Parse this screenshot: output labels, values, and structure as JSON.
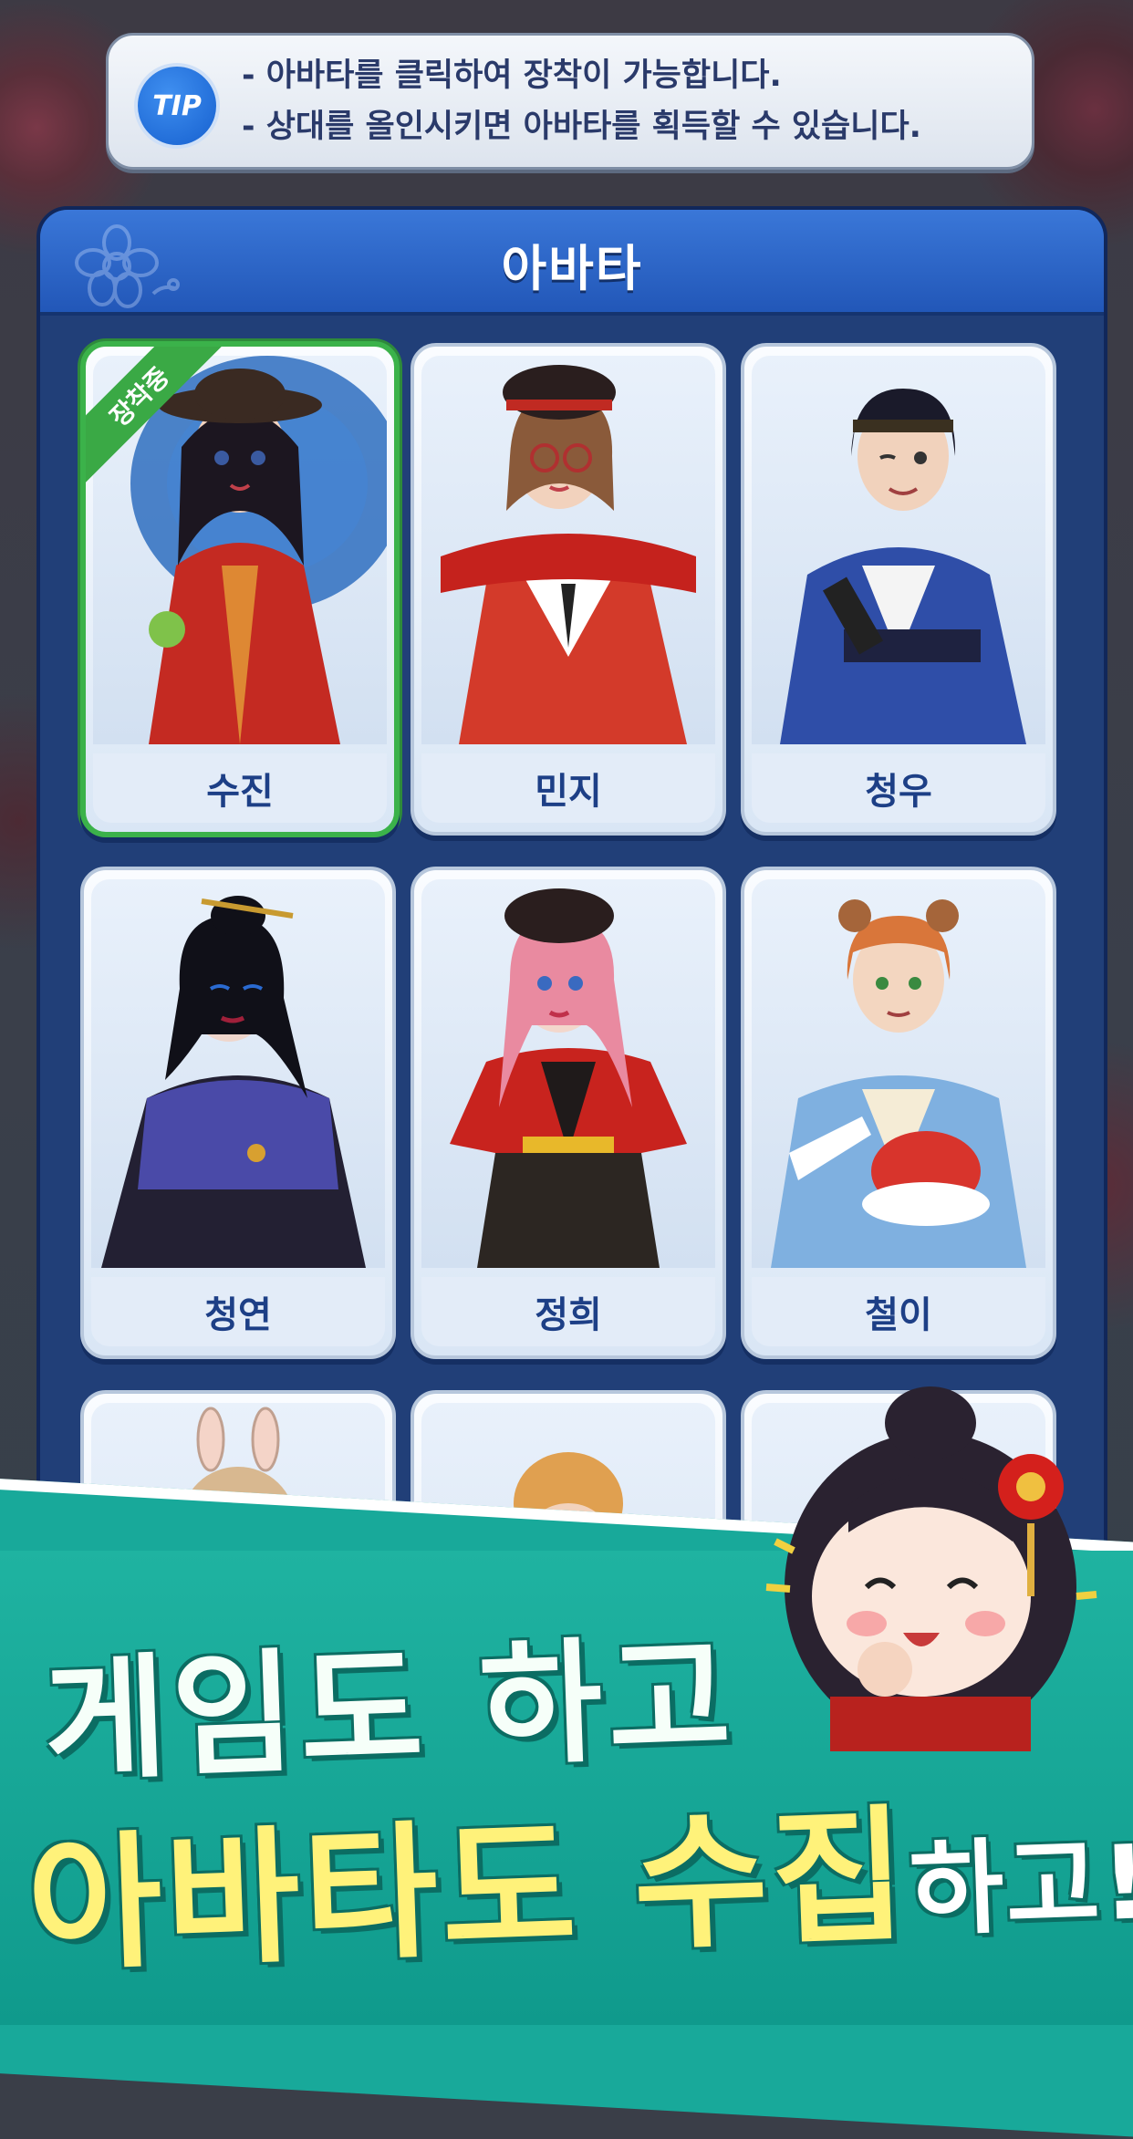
{
  "tip": {
    "badge": "TIP",
    "lines": [
      "- 아바타를 클릭하여 장착이 가능합니다.",
      "- 상대를 올인시키면 아바타를 획득할 수 있습니다."
    ]
  },
  "panel": {
    "title": "아바타",
    "equipped_label": "장착중",
    "avatars": [
      {
        "name": "수진",
        "equipped": true
      },
      {
        "name": "민지",
        "equipped": false
      },
      {
        "name": "청우",
        "equipped": false
      },
      {
        "name": "청연",
        "equipped": false
      },
      {
        "name": "정희",
        "equipped": false
      },
      {
        "name": "철이",
        "equipped": false
      },
      {
        "name": "",
        "equipped": false
      },
      {
        "name": "",
        "equipped": false
      },
      {
        "name": "",
        "equipped": false
      }
    ]
  },
  "promo": {
    "line1": "게임도 하고",
    "line2_highlight": "아바타도 수집",
    "line2_rest": "하고!"
  },
  "colors": {
    "panel_blue": "#1f3e78",
    "header_blue": "#2f6ad0",
    "equipped_green": "#3bb24a",
    "promo_teal": "#18a99a",
    "promo_yellow": "#fff27a"
  }
}
